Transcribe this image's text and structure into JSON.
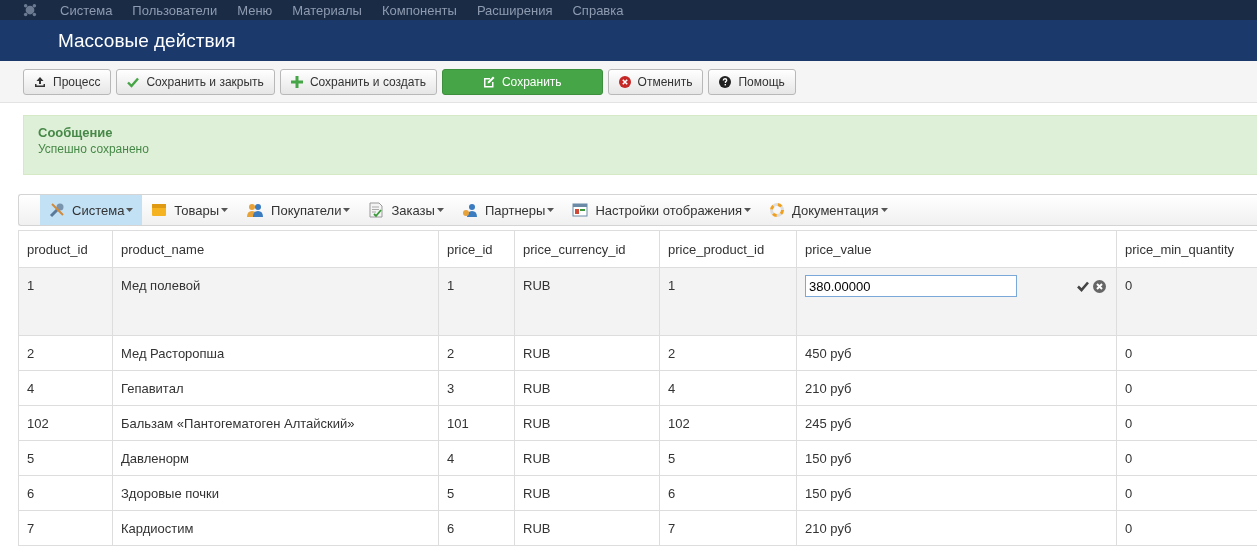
{
  "top_menu": [
    "Система",
    "Пользователи",
    "Меню",
    "Материалы",
    "Компоненты",
    "Расширения",
    "Справка"
  ],
  "page_title": "Массовые действия",
  "toolbar": [
    {
      "label": "Процесс",
      "kind": "upload"
    },
    {
      "label": "Сохранить и закрыть",
      "kind": "check"
    },
    {
      "label": "Сохранить и создать",
      "kind": "plus"
    },
    {
      "label": "Сохранить",
      "kind": "save"
    },
    {
      "label": "Отменить",
      "kind": "cancel"
    },
    {
      "label": "Помощь",
      "kind": "help"
    }
  ],
  "message": {
    "title": "Сообщение",
    "text": "Успешно сохранено"
  },
  "menu": [
    {
      "label": "Система",
      "kind": "wrench",
      "selected": true
    },
    {
      "label": "Товары",
      "kind": "box",
      "selected": false
    },
    {
      "label": "Покупатели",
      "kind": "users",
      "selected": false
    },
    {
      "label": "Заказы",
      "kind": "document",
      "selected": false
    },
    {
      "label": "Партнеры",
      "kind": "partner",
      "selected": false
    },
    {
      "label": "Настройки отображения",
      "kind": "window",
      "selected": false
    },
    {
      "label": "Документация",
      "kind": "lifebuoy",
      "selected": false
    }
  ],
  "table": {
    "columns": [
      "product_id",
      "product_name",
      "price_id",
      "price_currency_id",
      "price_product_id",
      "price_value",
      "price_min_quantity"
    ],
    "rows": [
      {
        "cells": [
          "1",
          "Мед полевой",
          "1",
          "RUB",
          "1",
          "380.00000",
          "0"
        ],
        "editing": true
      },
      {
        "cells": [
          "2",
          "Мед Расторопша",
          "2",
          "RUB",
          "2",
          "450 руб",
          "0"
        ],
        "editing": false
      },
      {
        "cells": [
          "4",
          "Гепавитал",
          "3",
          "RUB",
          "4",
          "210 руб",
          "0"
        ],
        "editing": false
      },
      {
        "cells": [
          "102",
          "Бальзам «Пантогематоген Алтайский»",
          "101",
          "RUB",
          "102",
          "245 руб",
          "0"
        ],
        "editing": false
      },
      {
        "cells": [
          "5",
          "Давленорм",
          "4",
          "RUB",
          "5",
          "150 руб",
          "0"
        ],
        "editing": false
      },
      {
        "cells": [
          "6",
          "Здоровые почки",
          "5",
          "RUB",
          "6",
          "150 руб",
          "0"
        ],
        "editing": false
      },
      {
        "cells": [
          "7",
          "Кардиостим",
          "6",
          "RUB",
          "7",
          "210 руб",
          "0"
        ],
        "editing": false
      }
    ]
  }
}
